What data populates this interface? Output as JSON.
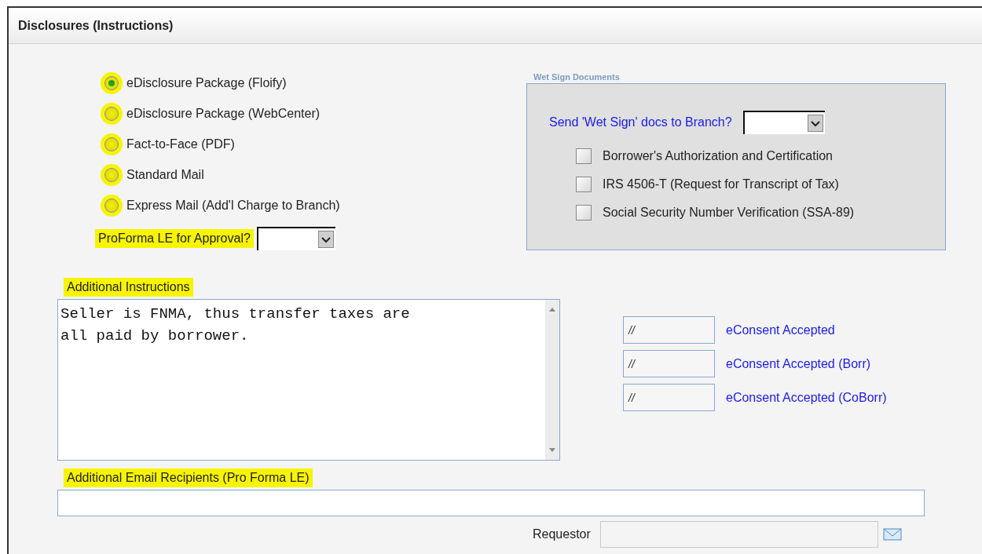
{
  "panel": {
    "title": "Disclosures (Instructions)"
  },
  "delivery_options": [
    {
      "label": "eDisclosure Package (Floify)",
      "selected": true,
      "highlighted": true
    },
    {
      "label": "eDisclosure Package (WebCenter)",
      "selected": false,
      "highlighted": true
    },
    {
      "label": "Fact-to-Face (PDF)",
      "selected": false,
      "highlighted": true
    },
    {
      "label": "Standard Mail",
      "selected": false,
      "highlighted": true
    },
    {
      "label": "Express Mail (Add'l Charge to Branch)",
      "selected": false,
      "highlighted": true
    }
  ],
  "proforma": {
    "label": "ProForma LE for Approval?",
    "highlighted": true
  },
  "wet_sign": {
    "legend": "Wet Sign Documents",
    "question": "Send 'Wet Sign' docs to Branch?",
    "documents": [
      {
        "label": "Borrower's Authorization and Certification",
        "checked": false
      },
      {
        "label": "IRS 4506-T (Request for Transcript of Tax)",
        "checked": false
      },
      {
        "label": "Social Security Number Verification (SSA-89)",
        "checked": false
      }
    ]
  },
  "instructions": {
    "label": "Additional Instructions",
    "highlighted": true,
    "value": "Seller is FNMA, thus transfer taxes are\nall paid by borrower."
  },
  "econsent": [
    {
      "value": "//",
      "label": "eConsent Accepted"
    },
    {
      "value": "//",
      "label": "eConsent Accepted (Borr)"
    },
    {
      "value": "//",
      "label": "eConsent Accepted (CoBorr)"
    }
  ],
  "email_recipients": {
    "label": "Additional Email Recipients (Pro Forma LE)",
    "highlighted": true
  },
  "requestor": {
    "label": "Requestor"
  }
}
